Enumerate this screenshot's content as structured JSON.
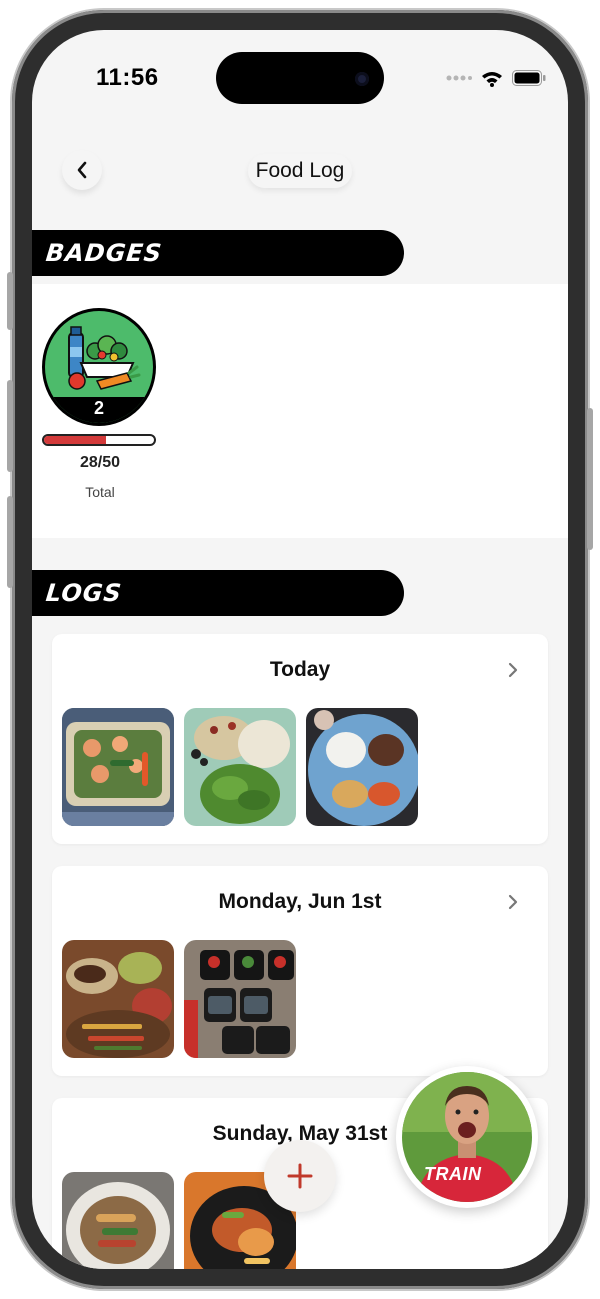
{
  "status_bar": {
    "time": "11:56"
  },
  "header": {
    "title": "Food Log"
  },
  "badges_section": {
    "heading": "BADGES",
    "badge": {
      "count": "2",
      "progress_fraction": 0.56,
      "value": "28/50",
      "label": "Total"
    }
  },
  "logs_section": {
    "heading": "LOGS",
    "entries": [
      {
        "date": "Today",
        "photos": [
          "shrimp-salad",
          "pasta-arugula-salad",
          "rice-steak-plate"
        ]
      },
      {
        "date": "Monday, Jun 1st",
        "photos": [
          "fajita-platter",
          "meal-prep-containers"
        ]
      },
      {
        "date": "Sunday, May 31st",
        "photos": [
          "chicken-veggie-bowl",
          "grilled-plate"
        ]
      }
    ]
  },
  "fab": {
    "icon": "plus-icon",
    "color": "#c0392b"
  },
  "coach": {
    "shirt_text": "TRAIN"
  },
  "colors": {
    "accent": "#d33a3a",
    "badge_green": "#4dbb6b",
    "section_bar": "#000000"
  }
}
